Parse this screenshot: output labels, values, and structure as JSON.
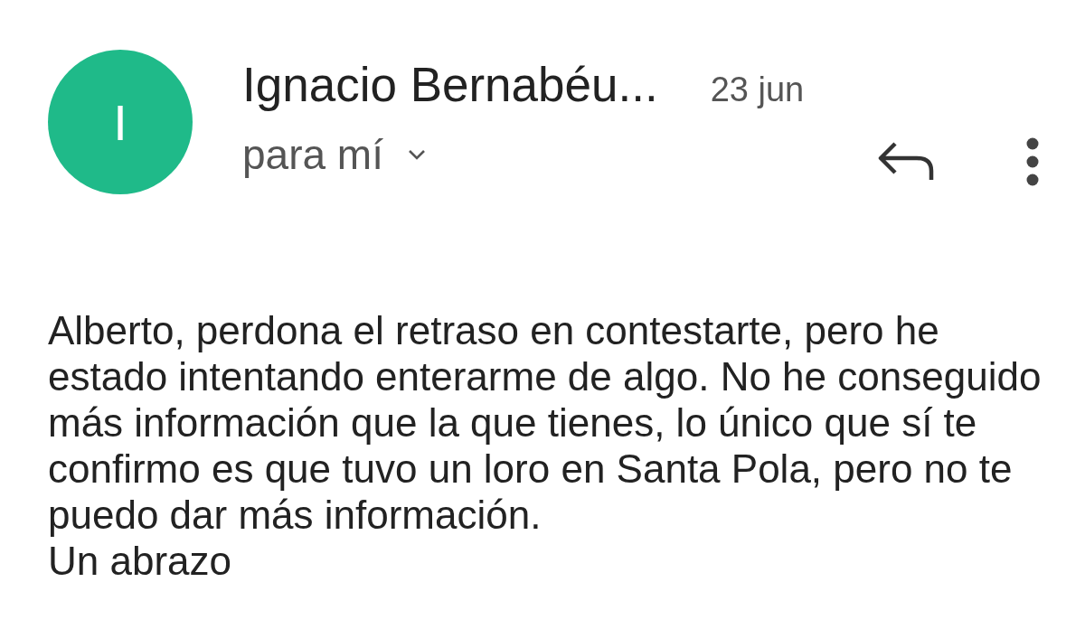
{
  "sender": {
    "avatar_letter": "I",
    "name": "Ignacio Bernabéu...",
    "date": "23 jun",
    "recipient": "para mí"
  },
  "body": {
    "message": "Alberto, perdona el retraso en contestarte, pero he estado intentando enterarme de algo. No he conseguido más información que la que tienes, lo único que sí te confirmo es que tuvo un loro en Santa Pola, pero no te puedo dar más información.",
    "closing": "Un abrazo"
  }
}
